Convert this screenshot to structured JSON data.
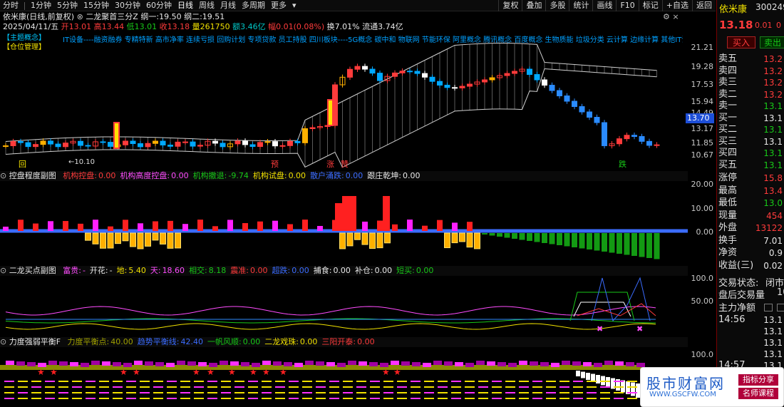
{
  "toolbar": {
    "timeframes": [
      "分时",
      "1分钟",
      "5分钟",
      "15分钟",
      "30分钟",
      "60分钟",
      "日线",
      "周线",
      "月线",
      "多周期",
      "更多"
    ],
    "active_index": 6,
    "right_buttons": [
      "复权",
      "叠加",
      "多股",
      "统计",
      "画线",
      "F10",
      "标记",
      "+自选",
      "返回"
    ],
    "accent": "#ffffff"
  },
  "stock": {
    "name": "依米康",
    "code": "300249"
  },
  "main_chart": {
    "title_line": "依米康(日线,前复权)",
    "indicator": "二龙聚首三分Z",
    "kang1_label": "纲一:",
    "kang1_value": "19.50",
    "kang2_label": "纲二:",
    "kang2_value": "19.51",
    "date_label": "2025/04/11/五",
    "open_label": "开",
    "open": "13.01",
    "high_label": "高",
    "high": "13.44",
    "low_label": "低",
    "low": "13.01",
    "close_label": "收",
    "close": "13.18",
    "vol_label": "量",
    "vol": "261750",
    "amt_label": "额",
    "amt": "3.46亿",
    "chg_label": "幅",
    "chg": "0.01(0.08%)",
    "turn_label": "换",
    "turn": "7.01%",
    "float_label": "流通",
    "float": "3.74亿",
    "tags_left": [
      "【主题概念】",
      "【仓位管理】"
    ],
    "concepts": "IT设备----融资融券 专精特新 高市净率 连续亏损 回购计划 专项贷款 员工持股 四川板块----5G概念 碳中和 物联网 节能环保 阿里概念 腾讯概念 百度概念 生物质能 垃圾分类 云计算 边缘计算 其他IT设备",
    "y_ticks": [
      "21.21",
      "19.28",
      "17.53",
      "15.94",
      "14.49",
      "13.17",
      "11.85",
      "10.67"
    ],
    "current_price_tag": "13.70",
    "low_label_text": "←10.10",
    "markers": [
      "回",
      "预",
      "涨",
      "赞",
      "跌"
    ]
  },
  "pane2": {
    "title": "控盘程度副图",
    "items": [
      {
        "label": "机构控盘:",
        "value": "0.00",
        "color": "#ff3b3b"
      },
      {
        "label": "机构高度控盘:",
        "value": "0.00",
        "color": "#ff4cff"
      },
      {
        "label": "机构撤退:",
        "value": "-9.74",
        "color": "#18c818"
      },
      {
        "label": "机构试盘:",
        "value": "0.00",
        "color": "#f0e000"
      },
      {
        "label": "散户涌跌:",
        "value": "0.00",
        "color": "#3b6cff"
      },
      {
        "label": "跟庄乾坤:",
        "value": "0.00",
        "color": "#e8e8e8"
      }
    ],
    "y_ticks": [
      "20.00",
      "10.00",
      "0.00"
    ]
  },
  "pane3": {
    "title": "二龙买点副图",
    "items": [
      {
        "label": "富贵:",
        "value": "-",
        "color": "#ff4cff"
      },
      {
        "label": "开花:",
        "value": "-",
        "color": "#e8e8e8"
      },
      {
        "label": "地:",
        "value": "5.40",
        "color": "#f0e000"
      },
      {
        "label": "天:",
        "value": "18.60",
        "color": "#ff4cff"
      },
      {
        "label": "相交:",
        "value": "8.18",
        "color": "#18c818"
      },
      {
        "label": "震准:",
        "value": "0.00",
        "color": "#ff3b3b"
      },
      {
        "label": "超跌:",
        "value": "0.00",
        "color": "#3b6cff"
      },
      {
        "label": "捕食:",
        "value": "0.00",
        "color": "#e8e8e8"
      },
      {
        "label": "补仓:",
        "value": "0.00",
        "color": "#e8e8e8"
      },
      {
        "label": "短买:",
        "value": "0.00",
        "color": "#18c818"
      }
    ],
    "y_ticks": [
      "100.0",
      "50.00"
    ]
  },
  "pane4": {
    "title": "力度强弱平衡F",
    "items": [
      {
        "label": "力度平衡点:",
        "value": "40.00",
        "color": "#a0a000"
      },
      {
        "label": "趋势平衡线:",
        "value": "42.40",
        "color": "#3b6cff"
      },
      {
        "label": "一帆风顺:",
        "value": "0.00",
        "color": "#18c818"
      },
      {
        "label": "二龙戏珠:",
        "value": "0.00",
        "color": "#f0e000"
      },
      {
        "label": "三阳开泰:",
        "value": "0.00",
        "color": "#ff3b3b"
      }
    ],
    "y_ticks": [
      "100.0"
    ]
  },
  "right_panel": {
    "price": "13.18",
    "change": "0.01",
    "change_pct": "0",
    "buy_btn": "买入",
    "sell_btn": "卖出",
    "order_book": [
      {
        "label": "卖五",
        "value": "13.2"
      },
      {
        "label": "卖四",
        "value": "13.2"
      },
      {
        "label": "卖三",
        "value": "13.2"
      },
      {
        "label": "卖二",
        "value": "13.2"
      },
      {
        "label": "卖一",
        "value": "13.1"
      },
      {
        "label": "买一",
        "value": "13.1"
      },
      {
        "label": "买二",
        "value": "13.1"
      },
      {
        "label": "买三",
        "value": "13.1"
      },
      {
        "label": "买四",
        "value": "13.1"
      },
      {
        "label": "买五",
        "value": "13.1"
      }
    ],
    "stats": [
      {
        "label": "涨停",
        "value": "15.8"
      },
      {
        "label": "最高",
        "value": "13.4"
      },
      {
        "label": "最低",
        "value": "13.0"
      },
      {
        "label": "现量",
        "value": "454"
      },
      {
        "label": "外盘",
        "value": "13122"
      },
      {
        "label": "换手",
        "value": "7.01"
      },
      {
        "label": "净资",
        "value": "0.9"
      },
      {
        "label": "收益(三)",
        "value": "0.02"
      }
    ],
    "trade_status_label": "交易状态:",
    "trade_status": "闭市",
    "after_hours_label": "盘后交易量",
    "after_hours": "10",
    "main_flow": "主力净额",
    "ticks": [
      {
        "time": "14:56",
        "value": "13.1"
      },
      {
        "time": "",
        "value": "13.1"
      },
      {
        "time": "",
        "value": "13.1"
      },
      {
        "time": "",
        "value": "13.1"
      },
      {
        "time": "14:57",
        "value": "13.1"
      },
      {
        "time": "",
        "value": "13.1"
      },
      {
        "time": "",
        "value": "13.1"
      },
      {
        "time": "",
        "value": "13.1"
      }
    ]
  },
  "watermark": {
    "title": "股市财富网",
    "url": "WWW.GSCFW.COM",
    "tag1": "指标分享",
    "tag2": "名师课程"
  }
}
